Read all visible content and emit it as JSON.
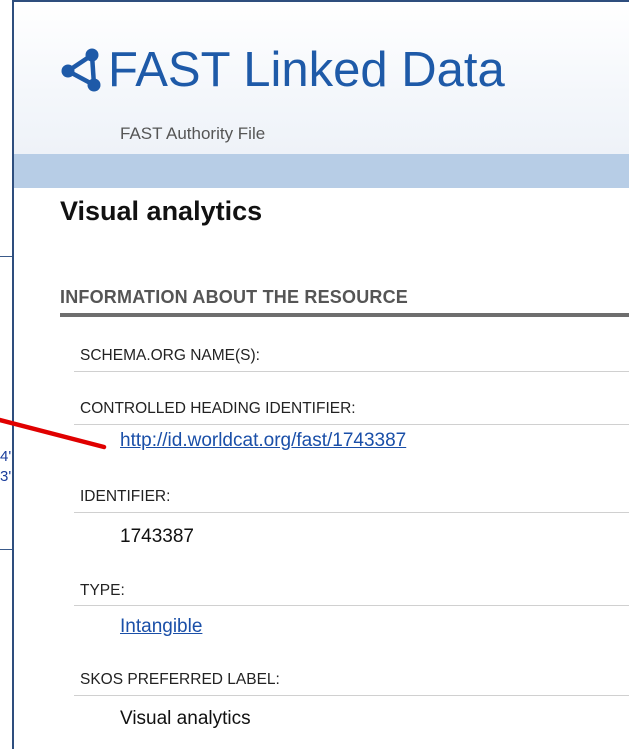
{
  "background": {
    "text_fragment_1": "4'",
    "text_fragment_2": "3'"
  },
  "header": {
    "title": "FAST Linked Data",
    "subtitle": "FAST Authority File",
    "logo_icon": "share-icon"
  },
  "page": {
    "title": "Visual analytics"
  },
  "section": {
    "heading": "INFORMATION ABOUT THE RESOURCE"
  },
  "properties": [
    {
      "label": "SCHEMA.ORG NAME(S):",
      "value": ""
    },
    {
      "label": "CONTROLLED HEADING IDENTIFIER:",
      "value": "http://id.worldcat.org/fast/1743387"
    },
    {
      "label": "IDENTIFIER:",
      "value": "1743387"
    },
    {
      "label": "TYPE:",
      "value": "Intangible"
    },
    {
      "label": "SKOS PREFERRED LABEL:",
      "value": "Visual analytics"
    }
  ],
  "colors": {
    "title_blue": "#1e5aa8",
    "bar_blue": "#b7cde6",
    "link_blue": "#1a4fa8",
    "annotation_red": "#e00000"
  }
}
